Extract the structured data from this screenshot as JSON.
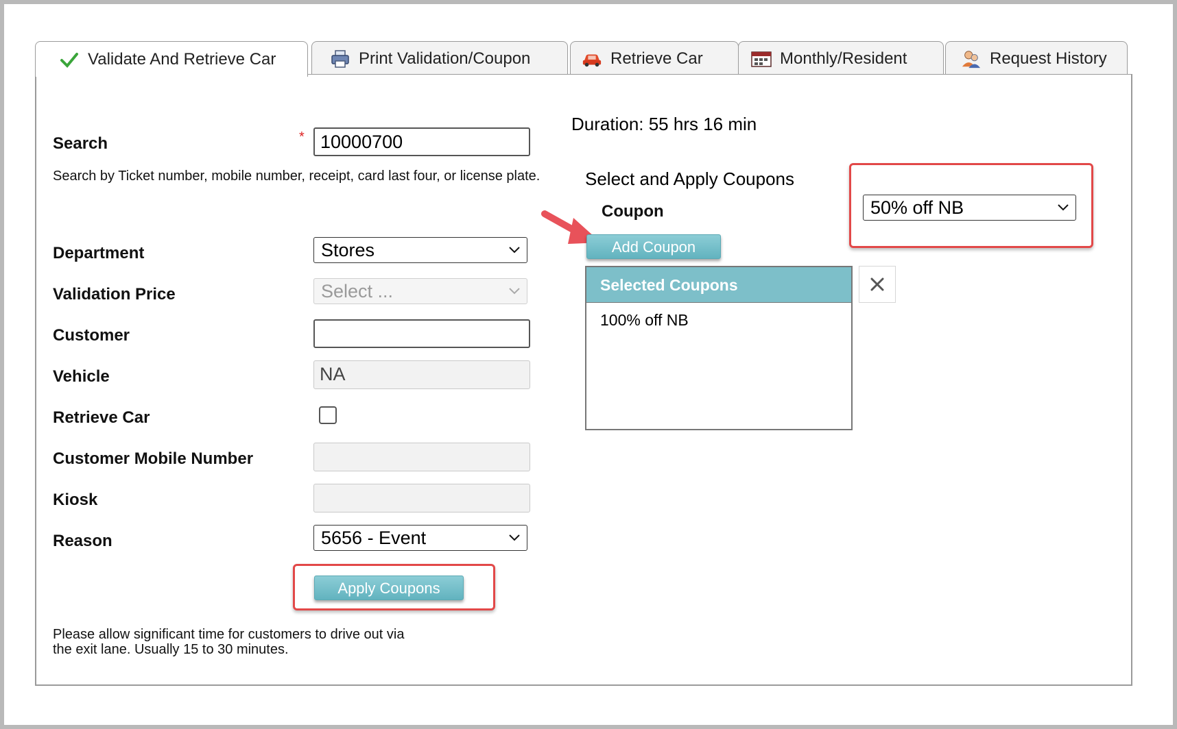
{
  "tabs": [
    {
      "label": "Validate And Retrieve Car",
      "icon": "checkmark-icon",
      "active": true
    },
    {
      "label": "Print Validation/Coupon",
      "icon": "printer-icon",
      "active": false
    },
    {
      "label": "Retrieve Car",
      "icon": "car-icon",
      "active": false
    },
    {
      "label": "Monthly/Resident",
      "icon": "calendar-icon",
      "active": false
    },
    {
      "label": "Request History",
      "icon": "users-icon",
      "active": false
    }
  ],
  "form": {
    "search_label": "Search",
    "required_mark": "*",
    "search_value": "10000700",
    "search_help": "Search by Ticket number, mobile number, receipt, card last four, or license plate.",
    "department_label": "Department",
    "department_value": "Stores",
    "validation_price_label": "Validation Price",
    "validation_price_placeholder": "Select ...",
    "customer_label": "Customer",
    "customer_value": "",
    "vehicle_label": "Vehicle",
    "vehicle_value": "NA",
    "retrieve_car_label": "Retrieve Car",
    "retrieve_car_checked": false,
    "mobile_label": "Customer Mobile Number",
    "mobile_value": "",
    "kiosk_label": "Kiosk",
    "kiosk_value": "",
    "reason_label": "Reason",
    "reason_value": "5656 - Event",
    "apply_button": "Apply Coupons",
    "note_line1": "Please allow significant time for customers to drive out via",
    "note_line2": "the exit lane. Usually 15 to 30 minutes."
  },
  "coupons": {
    "duration": "Duration: 55 hrs 16 min",
    "section_title": "Select and Apply Coupons",
    "coupon_label": "Coupon",
    "coupon_value": "50% off NB",
    "add_button": "Add Coupon",
    "selected_header": "Selected Coupons",
    "selected_items": [
      "100% off NB"
    ],
    "remove_icon": "close-icon"
  },
  "colors": {
    "accent_teal": "#7dbfc9",
    "annotation_red": "#e24848"
  }
}
